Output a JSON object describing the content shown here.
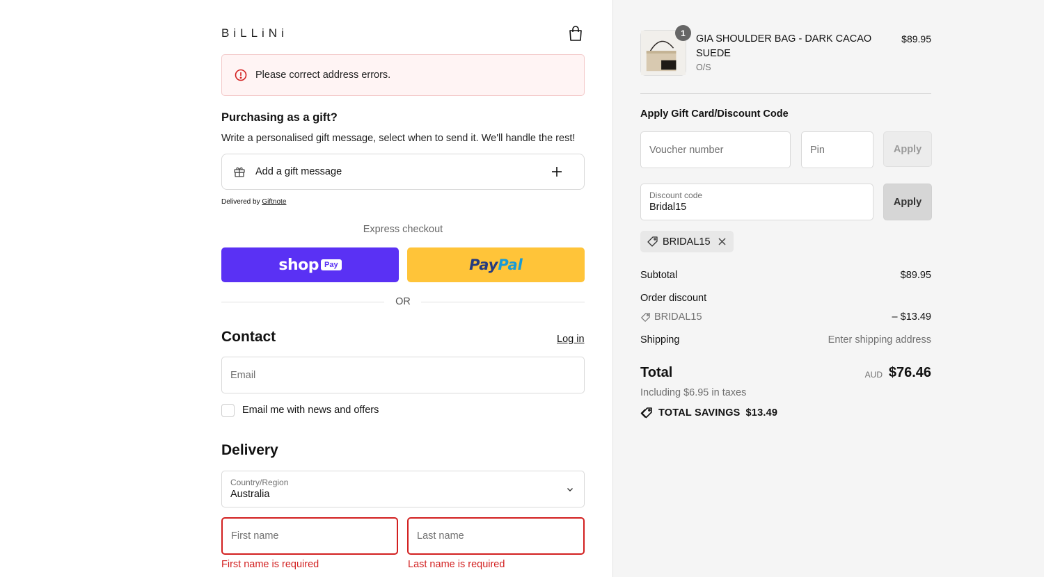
{
  "brand": {
    "logo_text": "BiLLiNi"
  },
  "alert": {
    "message": "Please correct address errors."
  },
  "gift": {
    "title": "Purchasing as a gift?",
    "description": "Write a personalised gift message, select when to send it. We'll handle the rest!",
    "add_label": "Add a gift message",
    "delivered_prefix": "Delivered by",
    "delivered_link": "Giftnote"
  },
  "express": {
    "label": "Express checkout",
    "shop_text": "shop",
    "shop_pay_pill": "Pay",
    "paypal_part1": "Pay",
    "paypal_part2": "Pal",
    "or_text": "OR"
  },
  "contact": {
    "heading": "Contact",
    "login_label": "Log in",
    "email_placeholder": "Email",
    "newsletter_label": "Email me with news and offers"
  },
  "delivery": {
    "heading": "Delivery",
    "country_label": "Country/Region",
    "country_value": "Australia",
    "first_name_placeholder": "First name",
    "last_name_placeholder": "Last name",
    "first_name_error": "First name is required",
    "last_name_error": "Last name is required"
  },
  "order": {
    "product": {
      "quantity": "1",
      "name": "GIA SHOULDER BAG - DARK CACAO SUEDE",
      "variant": "O/S",
      "price": "$89.95"
    },
    "gift_card": {
      "title": "Apply Gift Card/Discount Code",
      "voucher_placeholder": "Voucher number",
      "pin_placeholder": "Pin",
      "apply_label": "Apply"
    },
    "discount": {
      "label": "Discount code",
      "value": "Bridal15",
      "apply_label": "Apply",
      "chip_code": "BRIDAL15"
    },
    "summary": {
      "subtotal_label": "Subtotal",
      "subtotal_value": "$89.95",
      "order_discount_label": "Order discount",
      "discount_code": "BRIDAL15",
      "discount_value": "– $13.49",
      "shipping_label": "Shipping",
      "shipping_value": "Enter shipping address",
      "total_label": "Total",
      "total_currency": "AUD",
      "total_value": "$76.46",
      "taxes_text": "Including $6.95 in taxes",
      "savings_label": "TOTAL SAVINGS",
      "savings_value": "$13.49"
    }
  },
  "colors": {
    "shoppay": "#5a31f4",
    "paypal": "#ffc439",
    "error": "#d21f1f",
    "panel_bg": "#f5f5f5"
  }
}
